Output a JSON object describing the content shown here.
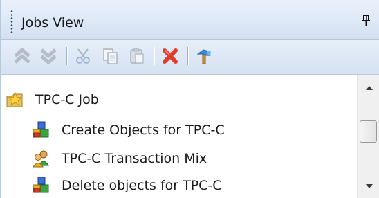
{
  "panel": {
    "title": "Jobs View",
    "pin_icon": "pin-icon"
  },
  "toolbar": {
    "buttons": [
      {
        "name": "move-up-button",
        "icon": "double-chevron-up-icon"
      },
      {
        "name": "move-down-button",
        "icon": "double-chevron-down-icon"
      },
      {
        "name": "cut-button",
        "icon": "scissors-icon"
      },
      {
        "name": "copy-button",
        "icon": "copy-icon"
      },
      {
        "name": "paste-button",
        "icon": "paste-icon"
      },
      {
        "name": "delete-button",
        "icon": "red-x-icon"
      },
      {
        "name": "properties-button",
        "icon": "tools-icon"
      }
    ]
  },
  "tree": {
    "job": {
      "label": "TPC-C Job",
      "icon": "star-folder-icon"
    },
    "items": [
      {
        "label": "Create Objects for TPC-C",
        "icon": "objects-icon"
      },
      {
        "label": "TPC-C Transaction Mix",
        "icon": "users-icon"
      },
      {
        "label": "Delete objects for TPC-C",
        "icon": "objects-icon"
      }
    ]
  },
  "colors": {
    "titlebar": "#dde8f6",
    "toolbar": "#d6e2f2",
    "delete_red": "#e23b2a"
  }
}
